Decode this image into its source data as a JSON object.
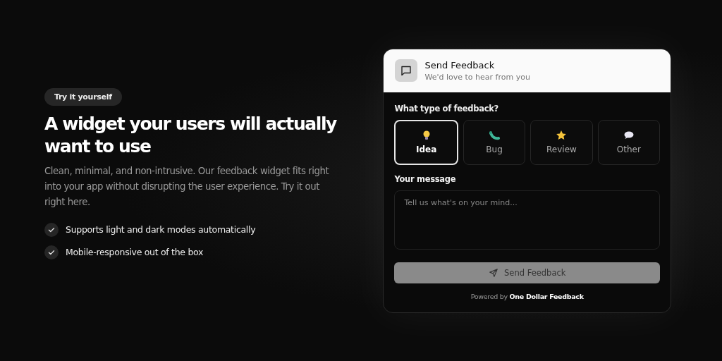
{
  "hero": {
    "badge": "Try it yourself",
    "heading": "A widget your users will actually want to use",
    "description": "Clean, minimal, and non-intrusive. Our feedback widget fits right into your app without disrupting the user experience. Try it out right here.",
    "features": [
      "Supports light and dark modes automatically",
      "Mobile-responsive out of the box"
    ]
  },
  "widget": {
    "title": "Send Feedback",
    "subtitle": "We'd love to hear from you",
    "type_label": "What type of feedback?",
    "types": [
      {
        "label": "Idea",
        "kind": "bulb",
        "selected": true
      },
      {
        "label": "Bug",
        "kind": "bug",
        "selected": false
      },
      {
        "label": "Review",
        "kind": "star",
        "selected": false
      },
      {
        "label": "Other",
        "kind": "bubble",
        "selected": false
      }
    ],
    "message_label": "Your message",
    "message": {
      "placeholder": "Tell us what's on your mind..."
    },
    "submit": {
      "label": "Send Feedback",
      "disabled": true
    },
    "footer": "Powered by **One Dollar Feedback**"
  }
}
